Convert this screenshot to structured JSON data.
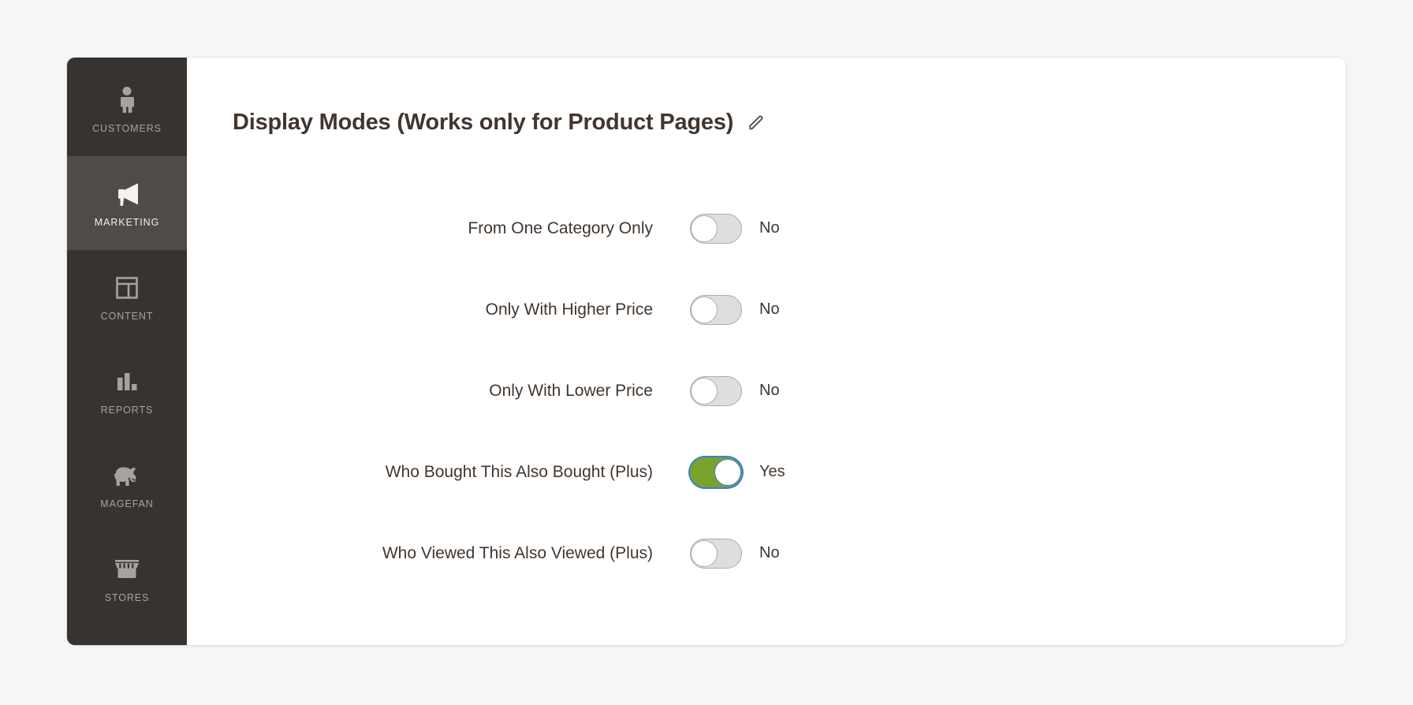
{
  "sidebar": {
    "items": [
      {
        "label": "CUSTOMERS",
        "icon": "customers-person-icon",
        "active": false
      },
      {
        "label": "MARKETING",
        "icon": "megaphone-icon",
        "active": true
      },
      {
        "label": "CONTENT",
        "icon": "layout-page-icon",
        "active": false
      },
      {
        "label": "REPORTS",
        "icon": "bar-chart-icon",
        "active": false
      },
      {
        "label": "MAGEFAN",
        "icon": "elephant-icon",
        "active": false
      },
      {
        "label": "STORES",
        "icon": "storefront-icon",
        "active": false
      }
    ]
  },
  "section": {
    "title": "Display Modes (Works only for Product Pages)",
    "edit_icon": "pencil-icon"
  },
  "fields": [
    {
      "label": "From One Category Only",
      "value": "No",
      "on": false
    },
    {
      "label": "Only With Higher Price",
      "value": "No",
      "on": false
    },
    {
      "label": "Only With Lower Price",
      "value": "No",
      "on": false
    },
    {
      "label": "Who Bought This Also Bought (Plus)",
      "value": "Yes",
      "on": true
    },
    {
      "label": "Who Viewed This Also Viewed (Plus)",
      "value": "No",
      "on": false
    }
  ],
  "colors": {
    "page_background": "#f6f6f6",
    "panel_background": "#ffffff",
    "sidebar_background": "#373330",
    "sidebar_active_background": "#504b47",
    "sidebar_label": "#a6a39f",
    "text": "#41362f",
    "toggle_on": "#79a22e",
    "toggle_off": "#dededd",
    "focus_ring": "#3d7fd0"
  }
}
